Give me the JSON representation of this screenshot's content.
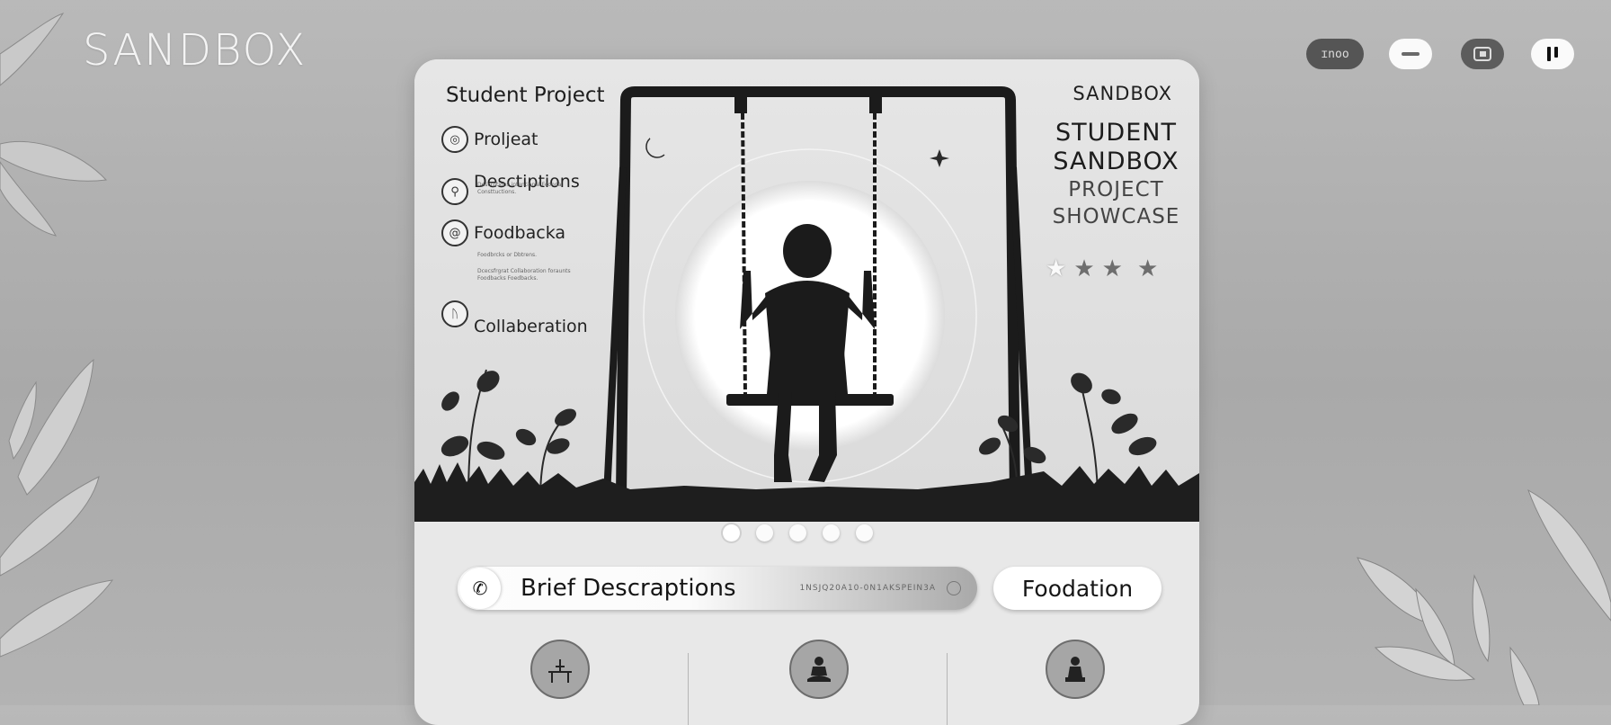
{
  "app": {
    "brand": "SANDBOX",
    "top_controls": [
      {
        "icon": "pill-toggle-icon",
        "label": "ɪnoo"
      },
      {
        "icon": "minus-icon",
        "label": ""
      },
      {
        "icon": "window-icon",
        "label": ""
      },
      {
        "icon": "pause-icon",
        "label": ""
      }
    ]
  },
  "card": {
    "hero_title": "Student Project",
    "features": [
      {
        "label": "Proljeat",
        "icon": "target-icon"
      },
      {
        "label": "Desctiptions",
        "icon": "person-icon",
        "sub": "Descrptions intentional Fconda Consttuctions."
      },
      {
        "label": "Foodbacka",
        "icon": "spiral-icon",
        "sub": "Foodbrcks or Dbtrens."
      },
      {
        "label": "Collaberation",
        "icon": "rune-icon",
        "sub": "Dcecsfrgrat Collaboration foraunts Foodbacks Foedbacks."
      }
    ],
    "side_brand": "SANDBOX",
    "side_title_lines": [
      "STUDENT",
      "SANDBOX"
    ],
    "side_subtitle_lines": [
      "PROJECT",
      "SHOWCASE"
    ],
    "rating": {
      "filled": 1,
      "total": 4
    },
    "carousel": {
      "count": 5,
      "active": 0
    },
    "search": {
      "value": "Brief Descraptions",
      "meta": "1NSJQ20A10-0N1AKSPEIN3A"
    },
    "pill_label": "Foodation",
    "bottom_icons": [
      "easel-icon",
      "meditation-icon",
      "seated-person-icon"
    ]
  },
  "colors": {
    "background": "#b1b1b1",
    "card": "#e8e8e8",
    "ink": "#1a1a1a"
  }
}
